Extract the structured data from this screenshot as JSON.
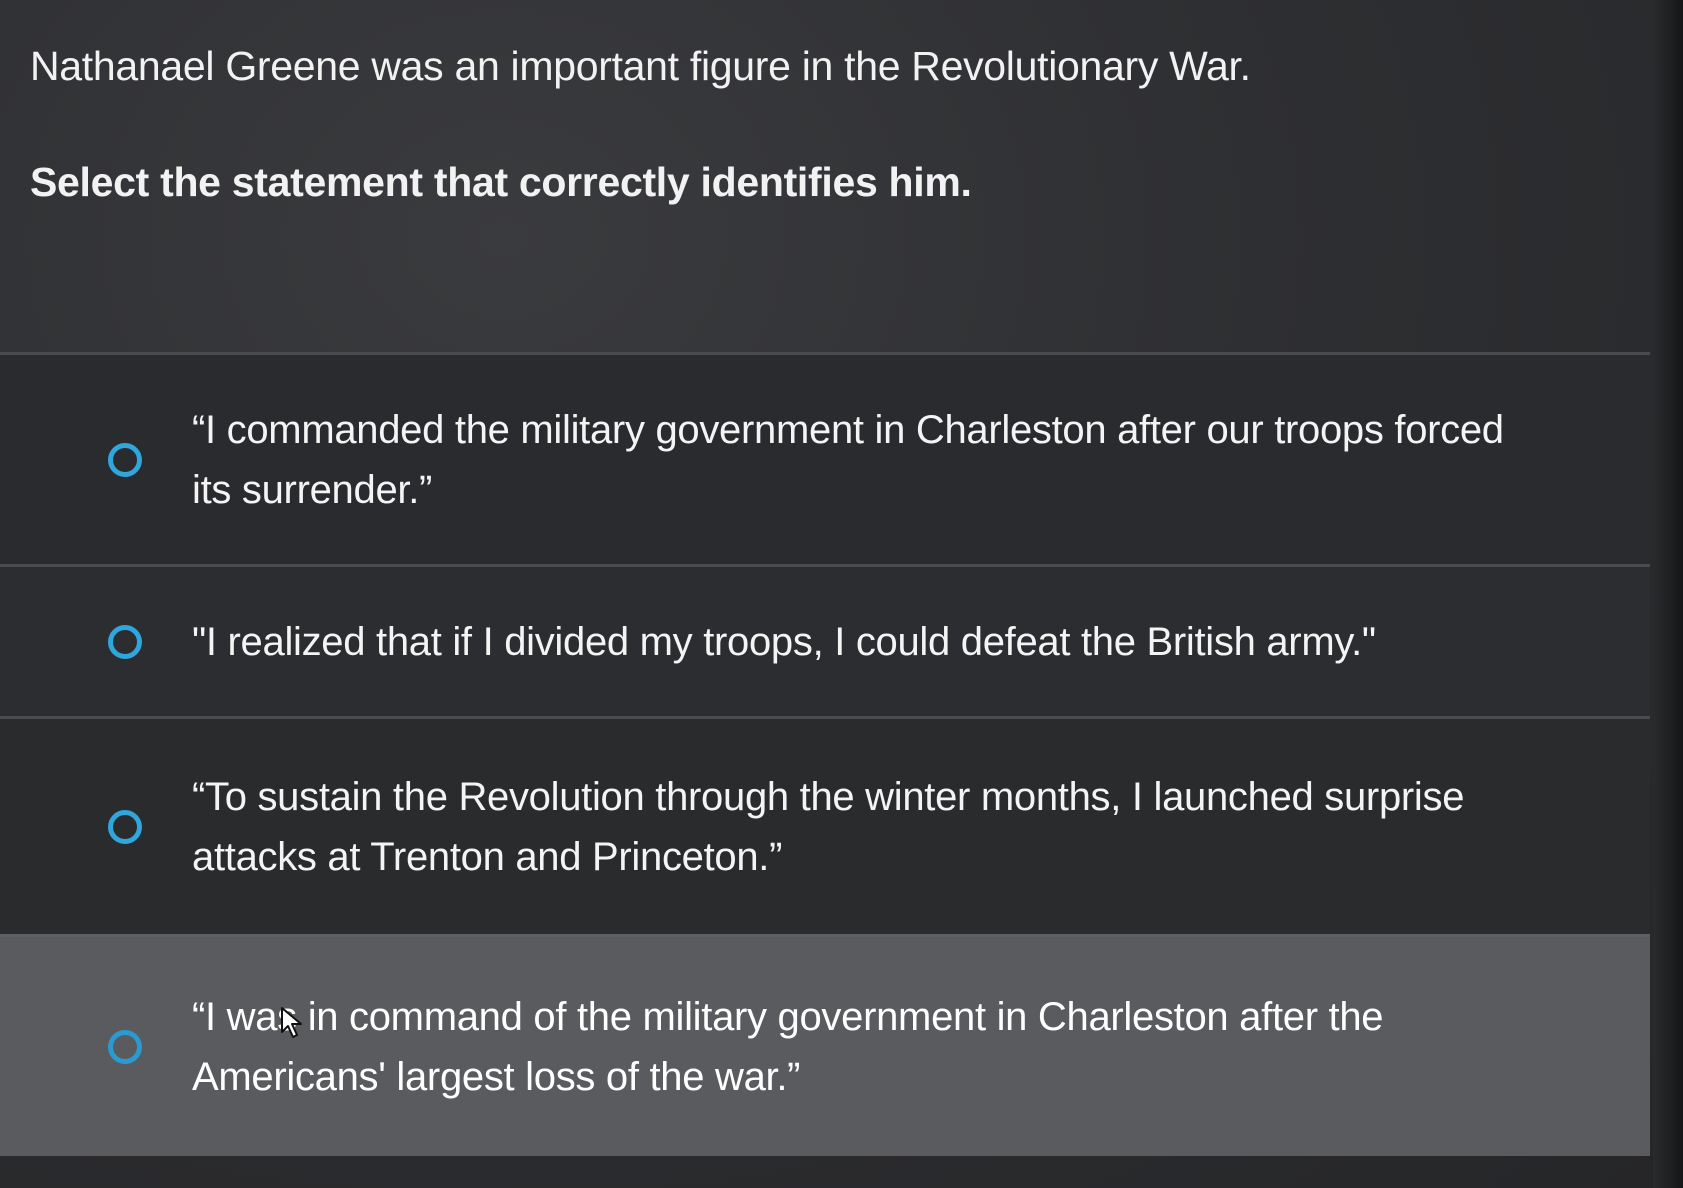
{
  "question": {
    "prompt": "Nathanael Greene was an important figure in the Revolutionary War.",
    "instruction": "Select the statement that correctly identifies him."
  },
  "choices": [
    {
      "text": "“I commanded the military government in Charleston after our troops forced its surrender.”"
    },
    {
      "text": "\"I realized that if I divided my troops, I could defeat the British army.\""
    },
    {
      "text": "“To sustain the Revolution through the winter months, I launched surprise attacks at Trenton and Princeton.”"
    },
    {
      "text": "“I was in command of the military government in Charleston after the Americans' largest loss of the war.”"
    }
  ],
  "colors": {
    "radio_border": "#2fa6dc",
    "hover_row": "#5a5b5f",
    "background": "#2b2c2f"
  },
  "icons": {
    "radio": "radio-unselected-icon",
    "cursor": "mouse-pointer-icon"
  }
}
